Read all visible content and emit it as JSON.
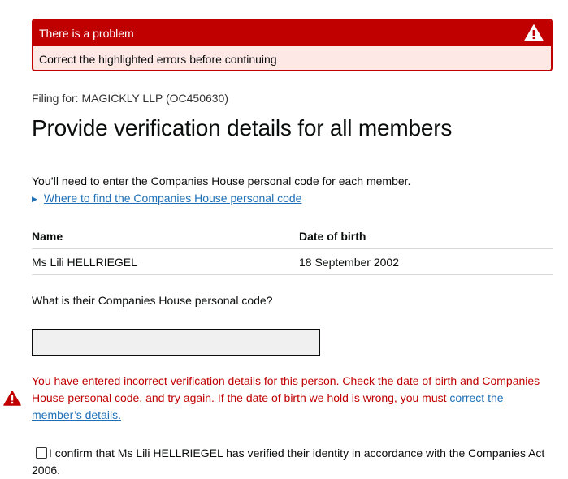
{
  "error_summary": {
    "title": "There is a problem",
    "message": "Correct the highlighted errors before continuing",
    "icon": "warning-triangle-icon"
  },
  "filing_for": "Filing for: MAGICKLY LLP (OC450630)",
  "heading": "Provide verification details for all members",
  "intro_text": "You’ll need to enter the Companies House personal code for each member.",
  "details_link": "Where to find the Companies House personal code",
  "table": {
    "headers": [
      "Name",
      "Date of birth"
    ],
    "rows": [
      [
        "Ms Lili HELLRIEGEL",
        "18 September 2002"
      ]
    ]
  },
  "question": "What is their Companies House personal code?",
  "code_input": {
    "value": "",
    "placeholder": ""
  },
  "error_message": {
    "text": "You have entered incorrect verification details for this person. Check the date of birth and Companies House personal code, and try again. If the date of birth we hold is wrong, you must",
    "link": "correct the member’s details."
  },
  "confirmation": "I confirm that Ms Lili HELLRIEGEL has verified their identity in accordance with the Companies Act 2006.",
  "colors": {
    "error": "#c00000",
    "error_bg": "#fde8e6",
    "link": "#1d70b8"
  }
}
